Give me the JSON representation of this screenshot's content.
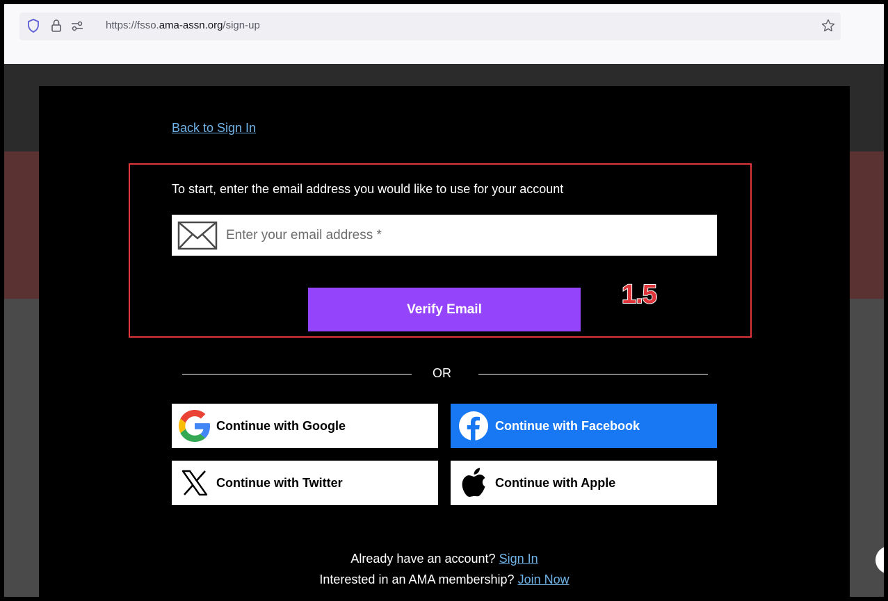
{
  "browser": {
    "url_prefix": "https://fsso.",
    "url_domain": "ama-assn.org",
    "url_path": "/sign-up"
  },
  "modal": {
    "back_link": "Back to Sign In",
    "prompt": "To start, enter the email address you would like to use for your account",
    "email_placeholder": "Enter your email address *",
    "verify_button": "Verify Email",
    "annotation": "1.5",
    "or_label": "OR",
    "sso": {
      "google": "Continue with Google",
      "facebook": "Continue with Facebook",
      "twitter": "Continue with Twitter",
      "apple": "Continue with Apple"
    },
    "footer": {
      "account_question": "Already have an account?",
      "sign_in_link": "Sign In",
      "membership_question": "Interested in an AMA membership?",
      "join_link": "Join Now"
    }
  },
  "colors": {
    "verify_button": "#9444fb",
    "facebook": "#1877f2",
    "link": "#6fb3e8",
    "highlight": "#e0353b"
  }
}
